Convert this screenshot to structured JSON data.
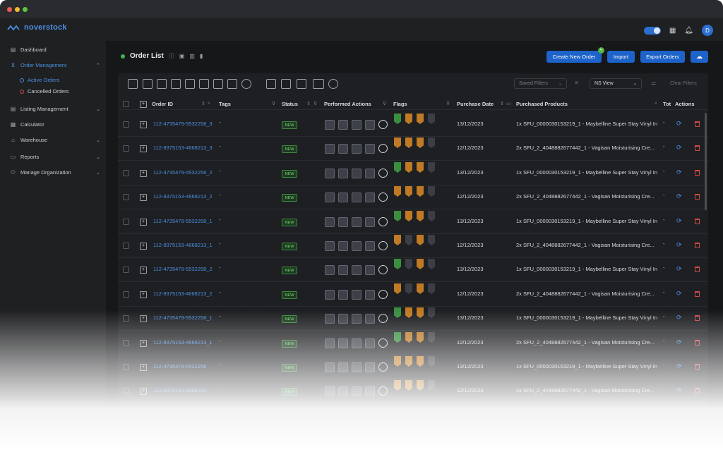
{
  "brand": {
    "name": "noverstock",
    "accent": "#4a8fe2"
  },
  "topbar": {
    "avatar_initial": "D",
    "icons": [
      "theme-toggle",
      "calendar-icon",
      "bell-icon"
    ]
  },
  "sidebar": {
    "items": [
      {
        "label": "Dashboard",
        "icon": "dashboard-icon"
      },
      {
        "label": "Order Management",
        "icon": "cart-icon",
        "active": true
      },
      {
        "label": "Listing Management",
        "icon": "list-icon"
      },
      {
        "label": "Calculator",
        "icon": "calculator-icon"
      },
      {
        "label": "Warehouse",
        "icon": "warehouse-icon"
      },
      {
        "label": "Reports",
        "icon": "reports-icon"
      },
      {
        "label": "Manage Organization",
        "icon": "organization-icon"
      }
    ],
    "sub_items": [
      {
        "label": "Active Orders",
        "active": true
      },
      {
        "label": "Cancelled Orders"
      }
    ]
  },
  "page": {
    "title": "Order List"
  },
  "actions": {
    "create_label": "Create New Order",
    "import_label": "Import",
    "export_label": "Export Orders"
  },
  "filters": {
    "saved_placeholder": "Saved Filters",
    "view_value": "NS View",
    "clear_label": "Clear Filters"
  },
  "table": {
    "headers": {
      "order_id": "Order ID",
      "tags": "Tags",
      "status": "Status",
      "performed": "Performed Actions",
      "flags": "Flags",
      "purchase_date": "Purchase Date",
      "products": "Purchased Products",
      "total": "Tot",
      "actions": "Actions"
    },
    "rows": [
      {
        "order_id": "112-4735479-5532258_3",
        "tags": "-",
        "status": "NEW",
        "flags": [
          "green",
          "orange",
          "orange",
          "dark"
        ],
        "date": "13/12/2023",
        "product": "1x SFU_0000030153219_1 - Maybelline Super Stay Vinyl In...",
        "total": "-"
      },
      {
        "order_id": "112-8375153-4668213_3",
        "tags": "-",
        "status": "NEW",
        "flags": [
          "orange",
          "orange",
          "orange",
          "dark"
        ],
        "date": "12/12/2023",
        "product": "2x SFU_2_4048882677442_1 - Vagisan Moisturising Cre...",
        "total": "-"
      },
      {
        "order_id": "112-4735479-5532258_2",
        "tags": "-",
        "status": "NEW",
        "flags": [
          "green",
          "orange",
          "orange",
          "dark"
        ],
        "date": "13/12/2023",
        "product": "1x SFU_0000030153219_1 - Maybelline Super Stay Vinyl In...",
        "total": "-"
      },
      {
        "order_id": "112-8375153-4668213_2",
        "tags": "-",
        "status": "NEW",
        "flags": [
          "orange",
          "orange",
          "orange",
          "dark"
        ],
        "date": "12/12/2023",
        "product": "2x SFU_2_4048882677442_1 - Vagisan Moisturising Cre...",
        "total": "-"
      },
      {
        "order_id": "112-4735479-5532258_1",
        "tags": "-",
        "status": "NEW",
        "flags": [
          "green",
          "orange",
          "orange",
          "dark"
        ],
        "date": "13/12/2023",
        "product": "1x SFU_0000030153219_1 - Maybelline Super Stay Vinyl In...",
        "total": "-"
      },
      {
        "order_id": "112-8375153-4668213_1",
        "tags": "-",
        "status": "NEW",
        "flags": [
          "orange",
          "dark",
          "orange",
          "dark"
        ],
        "date": "12/12/2023",
        "product": "2x SFU_2_4048882677442_1 - Vagisan Moisturising Cre...",
        "total": "-"
      },
      {
        "order_id": "112-4735479-5532258_2",
        "tags": "-",
        "status": "NEW",
        "flags": [
          "green",
          "dark",
          "orange",
          "dark"
        ],
        "date": "13/12/2023",
        "product": "1x SFU_0000030153219_1 - Maybelline Super Stay Vinyl In...",
        "total": "-"
      },
      {
        "order_id": "112-8375153-4668213_2",
        "tags": "-",
        "status": "NEW",
        "flags": [
          "orange",
          "dark",
          "orange",
          "dark"
        ],
        "date": "12/12/2023",
        "product": "2x SFU_2_4048882677442_1 - Vagisan Moisturising Cre...",
        "total": "-"
      },
      {
        "order_id": "112-4735479-5532258_1",
        "tags": "-",
        "status": "NEW",
        "flags": [
          "green",
          "orange",
          "orange",
          "dark"
        ],
        "date": "13/12/2023",
        "product": "1x SFU_0000030153219_1 - Maybelline Super Stay Vinyl In...",
        "total": "-"
      },
      {
        "order_id": "112-8375153-4668213_1",
        "tags": "-",
        "status": "NEW",
        "flags": [
          "green",
          "orange",
          "orange",
          "dark"
        ],
        "date": "12/12/2023",
        "product": "2x SFU_2_4048882677442_1 - Vagisan Moisturising Cre...",
        "total": "-"
      },
      {
        "order_id": "112-4735479-5532258",
        "tags": "-",
        "status": "NEW",
        "flags": [
          "orange",
          "orange",
          "orange",
          "dark"
        ],
        "date": "13/12/2023",
        "product": "1x SFU_0000030153219_1 - Maybelline Super Stay Vinyl In...",
        "total": "-"
      },
      {
        "order_id": "112-8375153-4668213",
        "tags": "-",
        "status": "NEW",
        "flags": [
          "orange",
          "orange",
          "orange",
          "dark"
        ],
        "date": "12/12/2023",
        "product": "2x SFU_2_4048882677442_1 - Vagisan Moisturising Cre...",
        "total": "-"
      }
    ]
  }
}
